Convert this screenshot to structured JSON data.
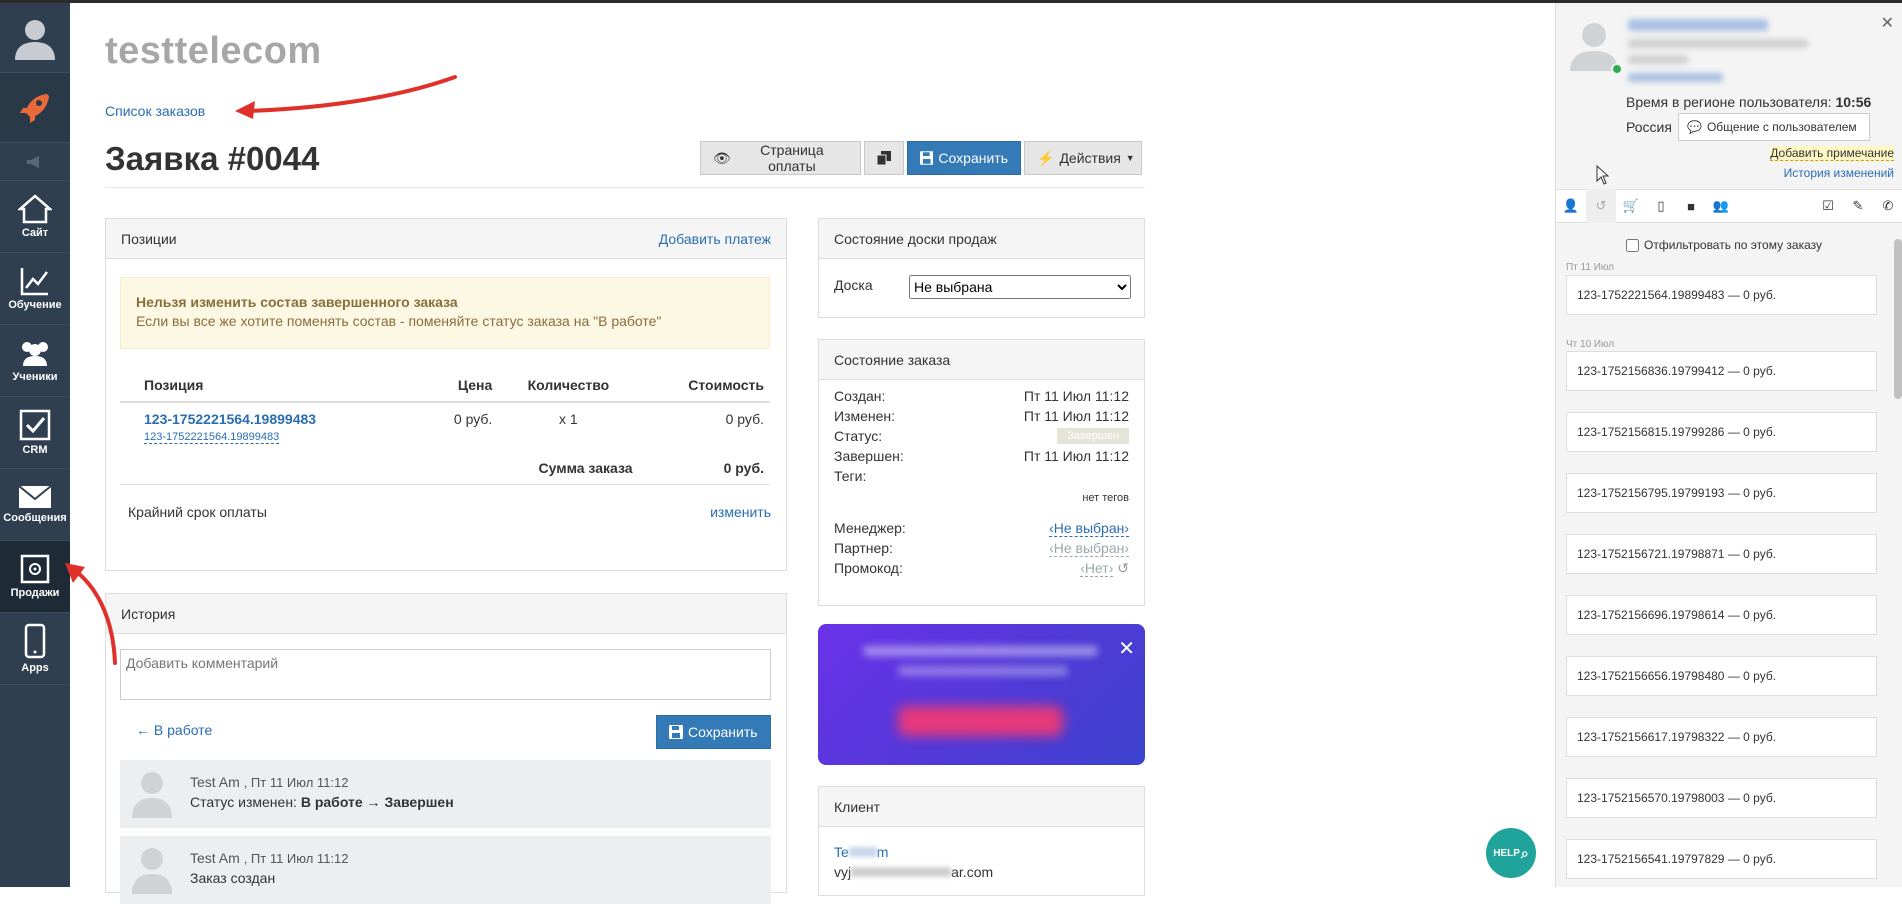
{
  "sidebar": {
    "items": [
      {
        "label": "",
        "icon": "rocket-icon"
      },
      {
        "label": "",
        "icon": "megaphone-icon"
      },
      {
        "label": "Сайт",
        "icon": "home-icon"
      },
      {
        "label": "Обучение",
        "icon": "chart-icon"
      },
      {
        "label": "Ученики",
        "icon": "users-icon"
      },
      {
        "label": "CRM",
        "icon": "checkbox-icon"
      },
      {
        "label": "Сообщения",
        "icon": "envelope-icon"
      },
      {
        "label": "Продажи",
        "icon": "safe-icon"
      },
      {
        "label": "Apps",
        "icon": "phone-icon"
      }
    ]
  },
  "header": {
    "brand": "testtelecom",
    "breadcrumb": "Список заказов",
    "title": "Заявка #0044",
    "buttons": {
      "pay_page": "Страница оплаты",
      "save": "Сохранить",
      "actions": "Действия"
    }
  },
  "positions": {
    "title": "Позиции",
    "add_payment": "Добавить платеж",
    "alert_title": "Нельзя изменить состав завершенного заказа",
    "alert_text": "Если вы все же хотите поменять состав - поменяйте статус заказа на \"В работе\"",
    "columns": [
      "Позиция",
      "Цена",
      "Количество",
      "Стоимость"
    ],
    "row": {
      "name": "123-1752221564.19899483",
      "sub": "123-1752221564.19899483",
      "price": "0 руб.",
      "qty": "x 1",
      "cost": "0 руб."
    },
    "sum_label": "Сумма заказа",
    "sum_value": "0 руб.",
    "deadline_label": "Крайний срок оплаты",
    "deadline_change": "изменить"
  },
  "history": {
    "title": "История",
    "comment_placeholder": "Добавить комментарий",
    "back_status": "← В работе",
    "save": "Сохранить",
    "entries": [
      {
        "author": "Test Am",
        "date": ", Пт 11 Июл 11:12",
        "text_prefix": "Статус изменен: ",
        "text_bold": "В работе → Завершен"
      },
      {
        "author": "Test Am",
        "date": ", Пт 11 Июл 11:12",
        "text_prefix": "Заказ создан",
        "text_bold": ""
      }
    ]
  },
  "board": {
    "title": "Состояние доски продаж",
    "label": "Доска",
    "selected": "Не выбрана"
  },
  "order_state": {
    "title": "Состояние заказа",
    "created_label": "Создан:",
    "created": "Пт 11 Июл 11:12",
    "changed_label": "Изменен:",
    "changed": "Пт 11 Июл 11:12",
    "status_label": "Статус:",
    "status": "Завершен",
    "finished_label": "Завершен:",
    "finished": "Пт 11 Июл 11:12",
    "tags_label": "Теги:",
    "tags": "нет тегов",
    "manager_label": "Менеджер:",
    "manager": "‹Не выбран›",
    "partner_label": "Партнер:",
    "partner": "‹Не выбран›",
    "promo_label": "Промокод:",
    "promo": "‹Нет›"
  },
  "client": {
    "title": "Клиент",
    "name_visible": "Te",
    "name_tail": "m",
    "email_head": "vyj",
    "email_tail": "ar.com",
    "extra": "- ..."
  },
  "user_panel": {
    "region_time_label": "Время в регионе пользователя:",
    "region_time": "10:56",
    "country": "Россия",
    "chat_button": "Общение с пользователем",
    "add_note": "Добавить примечание",
    "history_link": "История изменений",
    "filter_label": "Отфильтровать по этому заказу",
    "groups": [
      {
        "date": "Пт 11 Июл",
        "orders": [
          "123-1752221564.19899483 — 0 руб."
        ]
      },
      {
        "date": "Чт 10 Июл",
        "orders": [
          "123-1752156836.19799412 — 0 руб.",
          "123-1752156815.19799286 — 0 руб.",
          "123-1752156795.19799193 — 0 руб.",
          "123-1752156721.19798871 — 0 руб.",
          "123-1752156696.19798614 — 0 руб.",
          "123-1752156656.19798480 — 0 руб.",
          "123-1752156617.19798322 — 0 руб.",
          "123-1752156570.19798003 — 0 руб.",
          "123-1752156541.19797829 — 0 руб."
        ]
      }
    ]
  },
  "help_button": "HELP",
  "colors": {
    "sidebar": "#2f3f50",
    "primary": "#337ab7",
    "link": "#2a6db3",
    "alert_bg": "#fcf8e3",
    "help": "#1fa39a"
  }
}
